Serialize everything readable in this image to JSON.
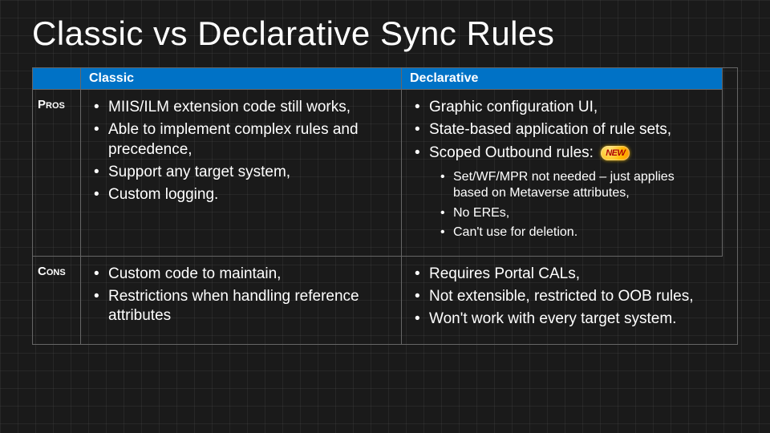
{
  "title": "Classic vs Declarative Sync Rules",
  "headers": {
    "col1": "Classic",
    "col2": "Declarative"
  },
  "rows": {
    "pros": {
      "label": "Pros",
      "classic": [
        "MIIS/ILM extension code still works,",
        "Able to implement complex rules and precedence,",
        "Support any target system,",
        "Custom logging."
      ],
      "declarative": {
        "top": [
          "Graphic configuration UI,",
          "State-based application of rule sets,"
        ],
        "scoped_prefix": "Scoped Outbound rules:",
        "new_badge": "NEW",
        "sub": [
          "Set/WF/MPR not needed – just applies based on Metaverse attributes,",
          "No EREs,",
          "Can't use for deletion."
        ]
      }
    },
    "cons": {
      "label": "Cons",
      "classic": [
        "Custom code to maintain,",
        "Restrictions when handling reference attributes"
      ],
      "declarative": [
        "Requires Portal CALs,",
        "Not extensible, restricted to OOB rules,",
        "Won't work with every target system."
      ]
    }
  }
}
